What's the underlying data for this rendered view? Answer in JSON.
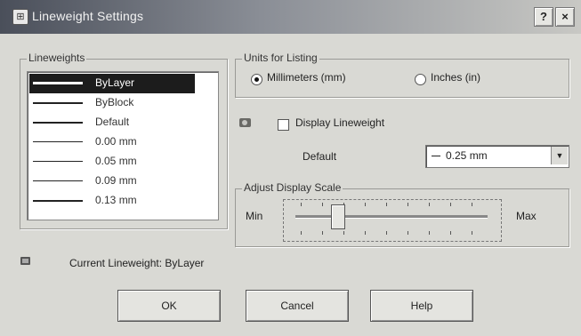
{
  "window": {
    "title": "Lineweight Settings",
    "help_button": "?",
    "close_button": "×"
  },
  "lineweights": {
    "label": "Lineweights",
    "items": [
      "ByLayer",
      "ByBlock",
      "Default",
      "0.00 mm",
      "0.05 mm",
      "0.09 mm",
      "0.13 mm"
    ],
    "selected_index": 0
  },
  "units": {
    "label": "Units for Listing",
    "millimeters": "Millimeters (mm)",
    "inches": "Inches (in)",
    "selected": "millimeters"
  },
  "display_lineweight": {
    "label": "Display Lineweight",
    "checked": false
  },
  "default": {
    "label": "Default",
    "value": "0.25 mm"
  },
  "scale": {
    "label": "Adjust Display Scale",
    "min_label": "Min",
    "max_label": "Max",
    "position": 0.2
  },
  "current": {
    "text": "Current Lineweight: ByLayer"
  },
  "buttons": {
    "ok": "OK",
    "cancel": "Cancel",
    "help": "Help"
  },
  "icons": {
    "title": "lineweight-app-icon",
    "info": "lineweight-info-icon",
    "current": "current-lineweight-icon"
  }
}
